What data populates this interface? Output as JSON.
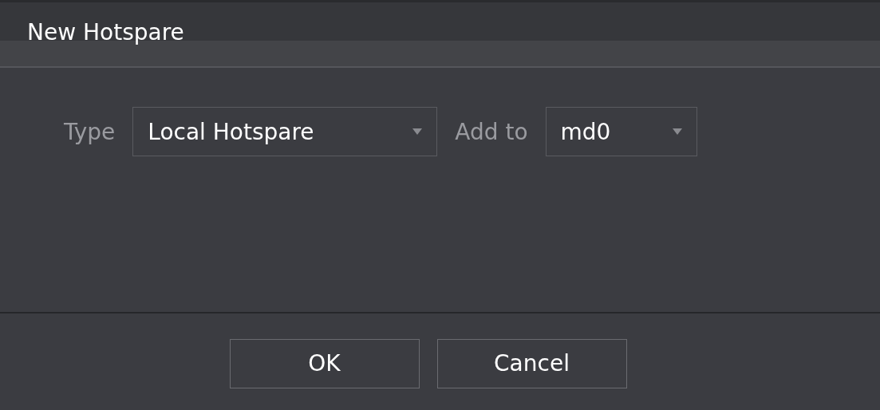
{
  "dialog": {
    "title": "New Hotspare"
  },
  "fields": [
    {
      "label": "Type",
      "value": "Local Hotspare"
    },
    {
      "label": "Add to",
      "value": "md0"
    }
  ],
  "buttons": [
    "OK",
    "Cancel"
  ]
}
